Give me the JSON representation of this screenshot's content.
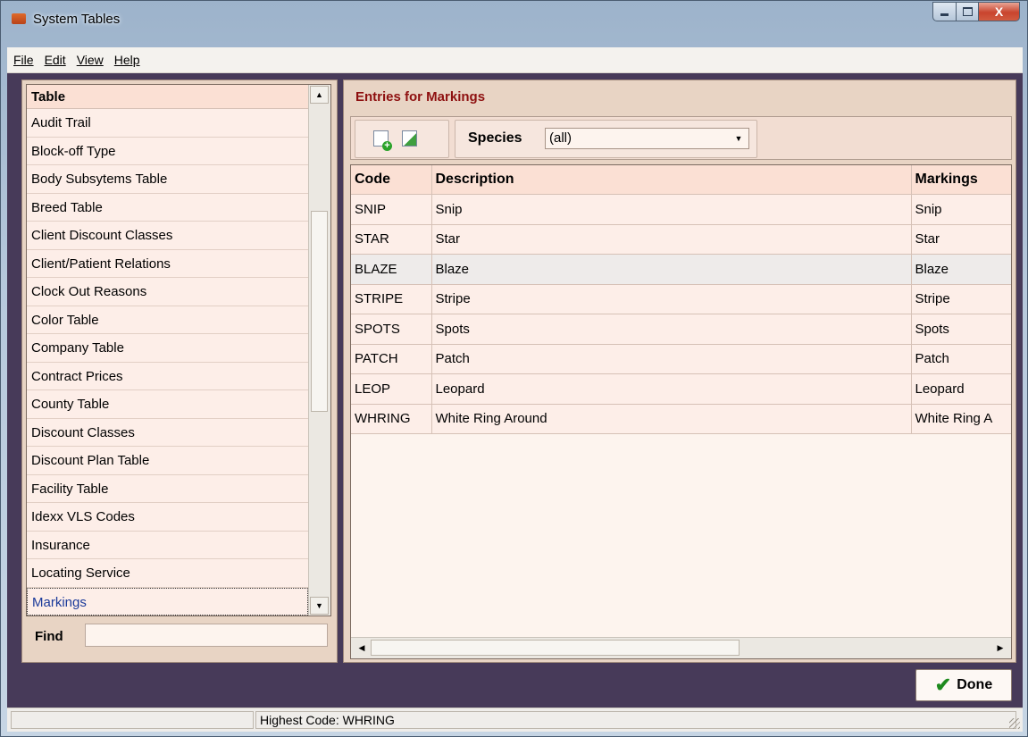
{
  "window": {
    "title": "System Tables",
    "minimize": "",
    "maximize": "",
    "close": "X"
  },
  "menu": [
    "File",
    "Edit",
    "View",
    "Help"
  ],
  "table_list": {
    "header": "Table",
    "items": [
      "Audit Trail",
      "Block-off Type",
      "Body Subsytems Table",
      "Breed Table",
      "Client Discount Classes",
      "Client/Patient Relations",
      "Clock Out Reasons",
      "Color Table",
      "Company Table",
      "Contract Prices",
      "County Table",
      "Discount Classes",
      "Discount Plan Table",
      "Facility Table",
      "Idexx VLS Codes",
      "Insurance",
      "Locating Service",
      "Markings"
    ],
    "selected": "Markings"
  },
  "find": {
    "label": "Find",
    "value": ""
  },
  "entries": {
    "title": "Entries for Markings",
    "species_label": "Species",
    "species_value": "(all)",
    "columns": [
      "Code",
      "Description",
      "Markings"
    ],
    "rows": [
      [
        "SNIP",
        "Snip",
        "Snip"
      ],
      [
        "STAR",
        "Star",
        "Star"
      ],
      [
        "BLAZE",
        "Blaze",
        "Blaze"
      ],
      [
        "STRIPE",
        "Stripe",
        "Stripe"
      ],
      [
        "SPOTS",
        "Spots",
        "Spots"
      ],
      [
        "PATCH",
        "Patch",
        "Patch"
      ],
      [
        "LEOP",
        "Leopard",
        "Leopard"
      ],
      [
        "WHRING",
        "White Ring Around",
        "White Ring A"
      ]
    ],
    "highlighted_row": 2
  },
  "done_label": "Done",
  "status": {
    "left": "",
    "right": "Highest Code: WHRING"
  }
}
